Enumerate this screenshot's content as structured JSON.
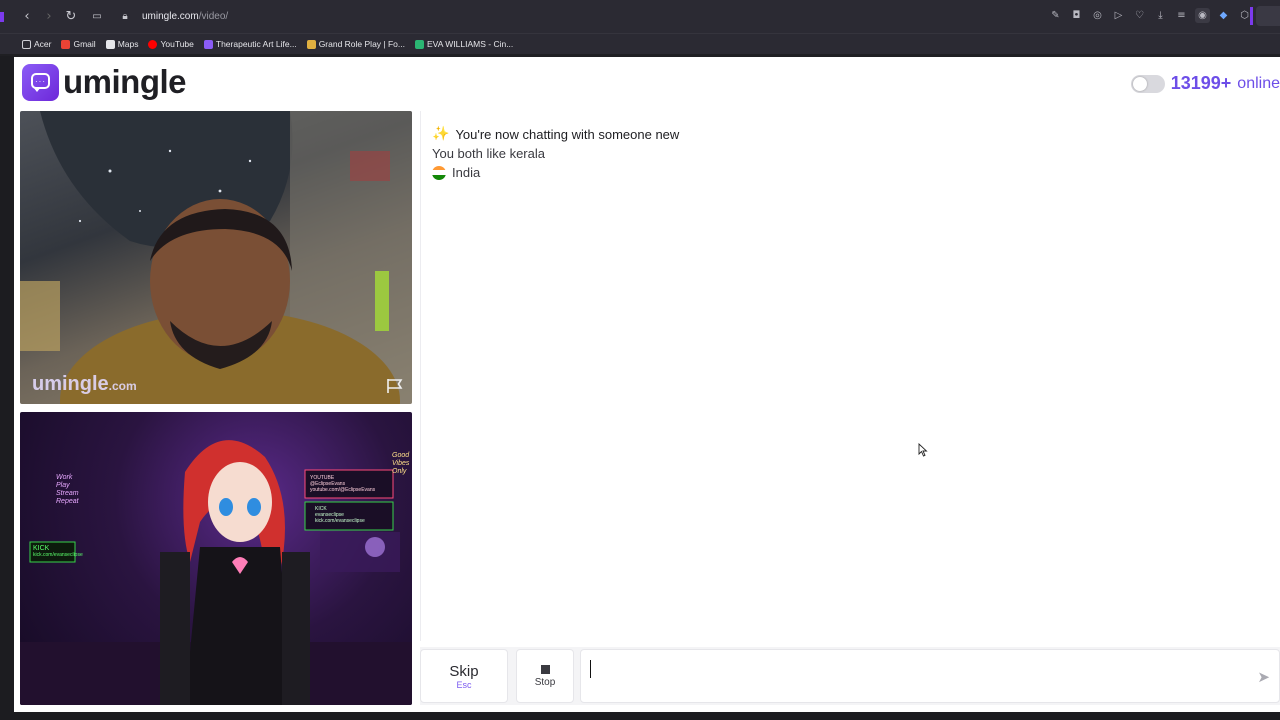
{
  "browser": {
    "url_host": "umingle.com",
    "url_path": "/video/",
    "bookmarks": [
      {
        "label": "Acer",
        "color": "#cfcfd6"
      },
      {
        "label": "Gmail",
        "color": "#ea4335"
      },
      {
        "label": "Maps",
        "color": "#e6e6ea"
      },
      {
        "label": "YouTube",
        "color": "#ff0000"
      },
      {
        "label": "Therapeutic Art Life...",
        "color": "#8b5cf6"
      },
      {
        "label": "Grand Role Play | Fo...",
        "color": "#e0b040"
      },
      {
        "label": "EVA WILLIAMS - Cin...",
        "color": "#2bb673"
      }
    ]
  },
  "site": {
    "logo_text": "umingle",
    "online_count": "13199+",
    "online_label": "online",
    "accent": "#6d4ee8"
  },
  "videos": {
    "stranger_watermark": "umingle",
    "stranger_watermark_tld": ".com",
    "self_overlay": {
      "youtube_label": "YOUTUBE",
      "youtube_handle": "@EclipseEvans",
      "youtube_url": "youtube.com/@EclipseEvans",
      "kick_label": "KICK",
      "kick_handle": "evanseclipse",
      "kick_url": "kick.com/evanseclipse",
      "sign_left": [
        "Work",
        "Play",
        "Stream",
        "Repeat"
      ],
      "sign_right": [
        "Good",
        "Vibes",
        "Only"
      ],
      "kick_badge": "KICK",
      "kick_badge_url": "kick.com/evanseclipse"
    }
  },
  "chat": {
    "title": "You're now chatting with someone new",
    "common_interest": "You both like kerala",
    "country": "India"
  },
  "controls": {
    "skip_label": "Skip",
    "skip_hint": "Esc",
    "stop_label": "Stop",
    "message_placeholder": ""
  }
}
